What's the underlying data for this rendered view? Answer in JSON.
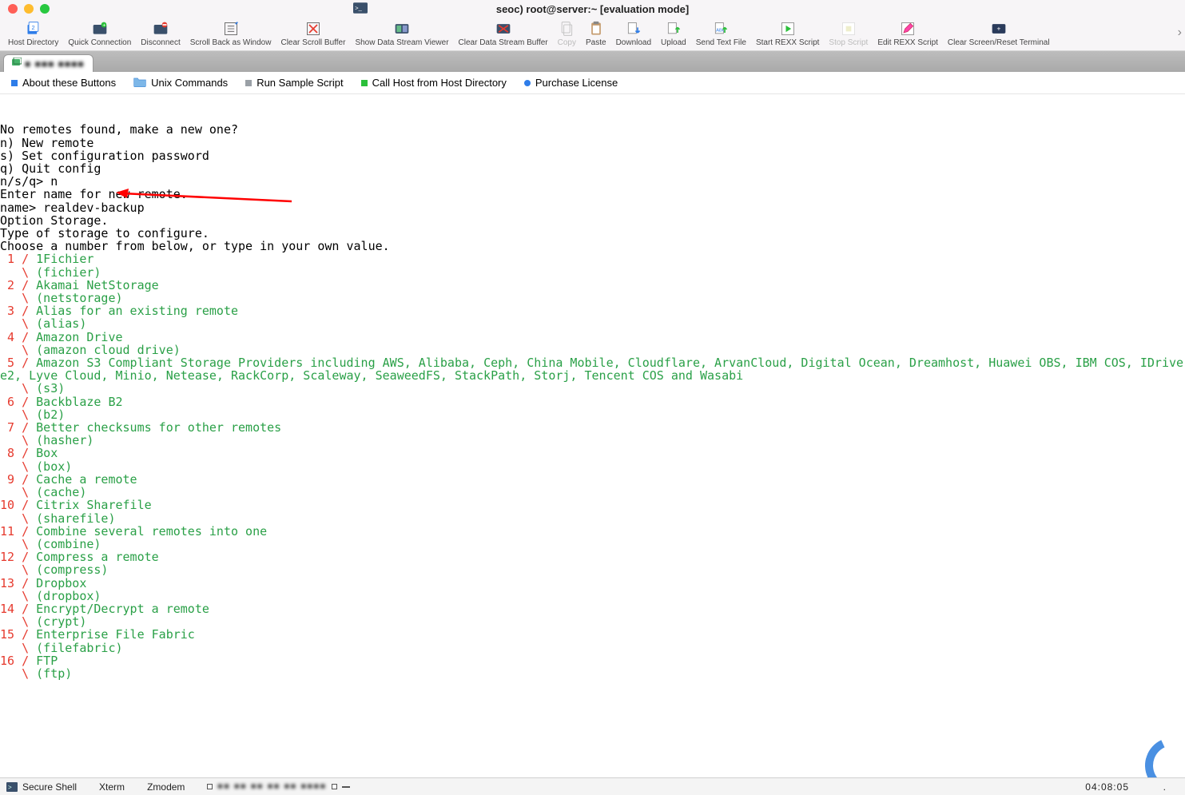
{
  "window": {
    "title": "seoc) root@server:~ [evaluation mode]"
  },
  "toolbar": {
    "items": [
      {
        "id": "host-directory",
        "label": "Host Directory"
      },
      {
        "id": "quick-connection",
        "label": "Quick Connection"
      },
      {
        "id": "disconnect",
        "label": "Disconnect"
      },
      {
        "id": "scroll-back-window",
        "label": "Scroll Back as Window"
      },
      {
        "id": "clear-scroll-buffer",
        "label": "Clear Scroll Buffer"
      },
      {
        "id": "show-dsv",
        "label": "Show Data Stream Viewer"
      },
      {
        "id": "clear-dsb",
        "label": "Clear Data Stream Buffer"
      },
      {
        "id": "copy",
        "label": "Copy",
        "disabled": true
      },
      {
        "id": "paste",
        "label": "Paste"
      },
      {
        "id": "download",
        "label": "Download"
      },
      {
        "id": "upload",
        "label": "Upload"
      },
      {
        "id": "send-text",
        "label": "Send Text File"
      },
      {
        "id": "start-rexx",
        "label": "Start REXX Script"
      },
      {
        "id": "stop-script",
        "label": "Stop Script",
        "disabled": true
      },
      {
        "id": "edit-rexx",
        "label": "Edit REXX Script"
      },
      {
        "id": "clear-reset",
        "label": "Clear Screen/Reset Terminal"
      }
    ]
  },
  "quickbar": {
    "about": "About these Buttons",
    "unix": "Unix Commands",
    "sample": "Run Sample Script",
    "callhost": "Call Host from Host Directory",
    "purchase": "Purchase License"
  },
  "terminal": {
    "tab_label_obscured": "■ ■■■ ■■■■",
    "intro": [
      "No remotes found, make a new one?",
      "n) New remote",
      "s) Set configuration password",
      "q) Quit config",
      "n/s/q> n",
      "",
      "Enter name for new remote.",
      "name> realdev-backup",
      "",
      "Option Storage.",
      "Type of storage to configure.",
      "Choose a number from below, or type in your own value."
    ],
    "options": [
      {
        "n": "1",
        "desc": "1Fichier",
        "code": "(fichier)"
      },
      {
        "n": "2",
        "desc": "Akamai NetStorage",
        "code": "(netstorage)"
      },
      {
        "n": "3",
        "desc": "Alias for an existing remote",
        "code": "(alias)"
      },
      {
        "n": "4",
        "desc": "Amazon Drive",
        "code": "(amazon cloud drive)"
      },
      {
        "n": "5",
        "desc": "Amazon S3 Compliant Storage Providers including AWS, Alibaba, Ceph, China Mobile, Cloudflare, ArvanCloud, Digital Ocean, Dreamhost, Huawei OBS, IBM COS, IDrive e2, Lyve Cloud, Minio, Netease, RackCorp, Scaleway, SeaweedFS, StackPath, Storj, Tencent COS and Wasabi",
        "code": "(s3)",
        "wrap": true
      },
      {
        "n": "6",
        "desc": "Backblaze B2",
        "code": "(b2)"
      },
      {
        "n": "7",
        "desc": "Better checksums for other remotes",
        "code": "(hasher)"
      },
      {
        "n": "8",
        "desc": "Box",
        "code": "(box)"
      },
      {
        "n": "9",
        "desc": "Cache a remote",
        "code": "(cache)"
      },
      {
        "n": "10",
        "desc": "Citrix Sharefile",
        "code": "(sharefile)"
      },
      {
        "n": "11",
        "desc": "Combine several remotes into one",
        "code": "(combine)"
      },
      {
        "n": "12",
        "desc": "Compress a remote",
        "code": "(compress)"
      },
      {
        "n": "13",
        "desc": "Dropbox",
        "code": "(dropbox)"
      },
      {
        "n": "14",
        "desc": "Encrypt/Decrypt a remote",
        "code": "(crypt)"
      },
      {
        "n": "15",
        "desc": "Enterprise File Fabric",
        "code": "(filefabric)"
      },
      {
        "n": "16",
        "desc": "FTP",
        "code": "(ftp)"
      }
    ]
  },
  "statusbar": {
    "shell": "Secure Shell",
    "emu": "Xterm",
    "transfer": "Zmodem",
    "leds_obscured": "■■ ■■ ■■ ■■ ■■ ■■■■",
    "time": "04:08:05"
  }
}
